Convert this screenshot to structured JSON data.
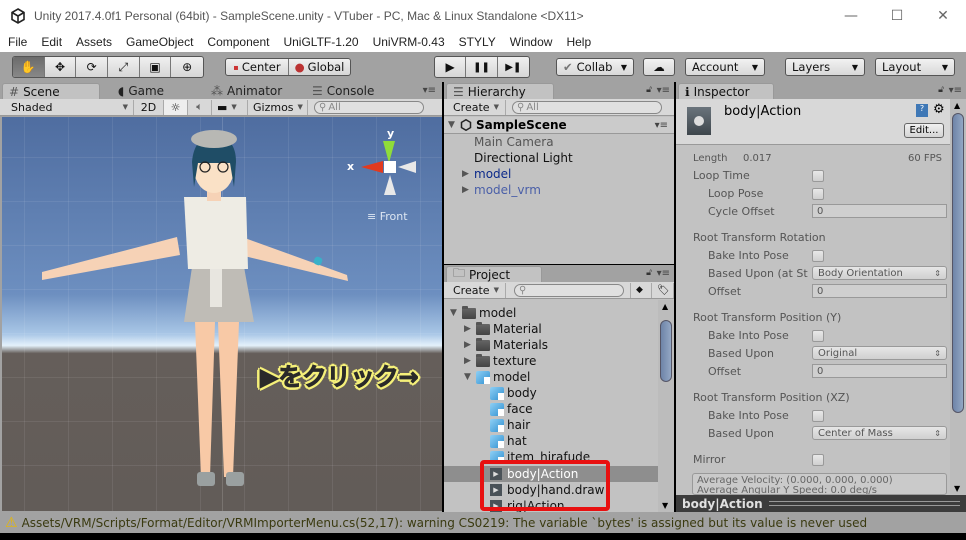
{
  "window": {
    "title": "Unity 2017.4.0f1 Personal (64bit) - SampleScene.unity - VTuber - PC, Mac & Linux Standalone <DX11>",
    "controls": {
      "minimize": "—",
      "maximize": "☐",
      "close": "✕"
    }
  },
  "menu": [
    "File",
    "Edit",
    "Assets",
    "GameObject",
    "Component",
    "UniGLTF-1.20",
    "UniVRM-0.43",
    "STYLY",
    "Window",
    "Help"
  ],
  "toolbar": {
    "tools": [
      {
        "name": "hand-tool",
        "glyph": "✋"
      },
      {
        "name": "move-tool",
        "glyph": "✥"
      },
      {
        "name": "rotate-tool",
        "glyph": "⟳"
      },
      {
        "name": "scale-tool",
        "glyph": "⤢"
      },
      {
        "name": "rect-tool",
        "glyph": "▣"
      },
      {
        "name": "transform-tool",
        "glyph": "⊕"
      }
    ],
    "pivot_label": "Center",
    "space_label": "Global",
    "play": "▶",
    "pause": "❚❚",
    "step": "▶❚",
    "collab_label": "Collab",
    "account_label": "Account",
    "layers_label": "Layers",
    "layout_label": "Layout"
  },
  "scene_panel": {
    "tabs": [
      {
        "label": "Scene",
        "icon": "#"
      },
      {
        "label": "Game",
        "icon": "◖"
      },
      {
        "label": "Animator",
        "icon": "⁂"
      },
      {
        "label": "Console",
        "icon": "☰"
      }
    ],
    "shading_mode": "Shaded",
    "mode_2d": "2D",
    "gizmos_label": "Gizmos",
    "search_placeholder": "All",
    "gizmo": {
      "y_label": "y",
      "x_label": "x",
      "view_label": "Front"
    },
    "annotation": "▶をクリック→"
  },
  "hierarchy": {
    "tab_label": "Hierarchy",
    "create_label": "Create",
    "search_placeholder": "All",
    "scene_name": "SampleScene",
    "items": [
      {
        "label": "Main Camera",
        "color": "#555555",
        "expandable": false
      },
      {
        "label": "Directional Light",
        "color": "#111111",
        "expandable": false
      },
      {
        "label": "model",
        "color": "#0c2a8a",
        "expandable": true
      },
      {
        "label": "model_vrm",
        "color": "#4a5fa8",
        "expandable": true
      }
    ]
  },
  "project": {
    "tab_label": "Project",
    "create_label": "Create",
    "items": [
      {
        "label": "model",
        "type": "folder",
        "depth": 0,
        "expanded": true
      },
      {
        "label": "Material",
        "type": "folder",
        "depth": 1,
        "expanded": false
      },
      {
        "label": "Materials",
        "type": "folder",
        "depth": 1,
        "expanded": false
      },
      {
        "label": "texture",
        "type": "folder",
        "depth": 1,
        "expanded": false
      },
      {
        "label": "model",
        "type": "mesh",
        "depth": 1,
        "expanded": true
      },
      {
        "label": "body",
        "type": "mesh",
        "depth": 2
      },
      {
        "label": "face",
        "type": "mesh",
        "depth": 2
      },
      {
        "label": "hair",
        "type": "mesh",
        "depth": 2
      },
      {
        "label": "hat",
        "type": "mesh",
        "depth": 2
      },
      {
        "label": "item_hirafude",
        "type": "mesh",
        "depth": 2
      },
      {
        "label": "body|Action",
        "type": "anim",
        "depth": 2,
        "selected": true
      },
      {
        "label": "body|hand.draw",
        "type": "anim",
        "depth": 2
      },
      {
        "label": "rig|Action",
        "type": "anim",
        "depth": 2
      }
    ]
  },
  "inspector": {
    "tab_label": "Inspector",
    "asset_name": "body|Action",
    "edit_label": "Edit...",
    "length_label": "Length",
    "length_value": "0.017",
    "fps": "60 FPS",
    "loop_time": "Loop Time",
    "loop_pose": "Loop Pose",
    "cycle_offset": "Cycle Offset",
    "cycle_offset_value": "0",
    "rot_header": "Root Transform Rotation",
    "rot_bake": "Bake Into Pose",
    "rot_based": "Based Upon (at St",
    "rot_based_value": "Body Orientation",
    "rot_offset": "Offset",
    "rot_offset_value": "0",
    "posy_header": "Root Transform Position (Y)",
    "posy_bake": "Bake Into Pose",
    "posy_based": "Based Upon",
    "posy_based_value": "Original",
    "posy_offset": "Offset",
    "posy_offset_value": "0",
    "posxz_header": "Root Transform Position (XZ)",
    "posxz_bake": "Bake Into Pose",
    "posxz_based": "Based Upon",
    "posxz_based_value": "Center of Mass",
    "mirror": "Mirror",
    "avg_velocity": "Average Velocity: (0.000, 0.000, 0.000)",
    "avg_angular": "Average Angular Y Speed: 0.0 deg/s",
    "preview_title": "body|Action"
  },
  "status": {
    "message": "Assets/VRM/Scripts/Format/Editor/VRMImporterMenu.cs(52,17): warning CS0219: The variable `bytes' is assigned but its value is never used"
  },
  "colors": {
    "highlight_box": "#e81010",
    "annotation_outline": "#f5f07a",
    "editor_bg": "#c2c2c2"
  }
}
